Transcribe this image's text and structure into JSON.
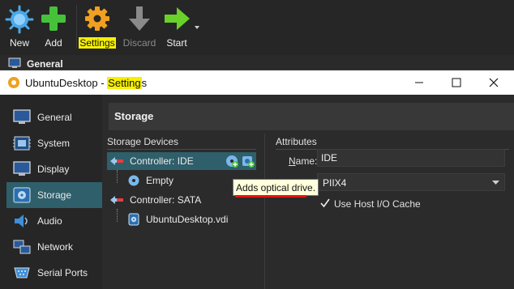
{
  "toolbar": {
    "new_label": "New",
    "add_label": "Add",
    "settings_label": "Settings",
    "discard_label": "Discard",
    "start_label": "Start"
  },
  "background": {
    "general_label": "General"
  },
  "dialog": {
    "title_prefix": "UbuntuDesktop - ",
    "title_highlight": "Setting",
    "title_suffix": "s"
  },
  "sidebar": {
    "items": [
      {
        "label": "General",
        "icon": "general-icon"
      },
      {
        "label": "System",
        "icon": "system-icon"
      },
      {
        "label": "Display",
        "icon": "display-icon"
      },
      {
        "label": "Storage",
        "icon": "storage-icon",
        "selected": true
      },
      {
        "label": "Audio",
        "icon": "audio-icon"
      },
      {
        "label": "Network",
        "icon": "network-icon"
      },
      {
        "label": "Serial Ports",
        "icon": "serial-ports-icon"
      }
    ]
  },
  "storage": {
    "header": "Storage",
    "devices_label": "Storage Devices",
    "attributes_label": "Attributes",
    "tree": {
      "controller_ide": "Controller: IDE",
      "empty": "Empty",
      "controller_sata": "Controller: SATA",
      "disk": "UbuntuDesktop.vdi"
    },
    "name_label": "Name:",
    "name_value": "IDE",
    "type_value": "PIIX4",
    "host_io_cache_label": "Use Host I/O Cache",
    "host_io_cache_checked": true
  },
  "tooltip": {
    "text": "Adds optical drive."
  },
  "colors": {
    "highlight": "#f6f000",
    "selection": "#2f5f6a",
    "new_icon": "#4aa8e8",
    "add_icon": "#46c23a",
    "settings_icon": "#f0a020",
    "tooltip_underline": "#e81010"
  }
}
